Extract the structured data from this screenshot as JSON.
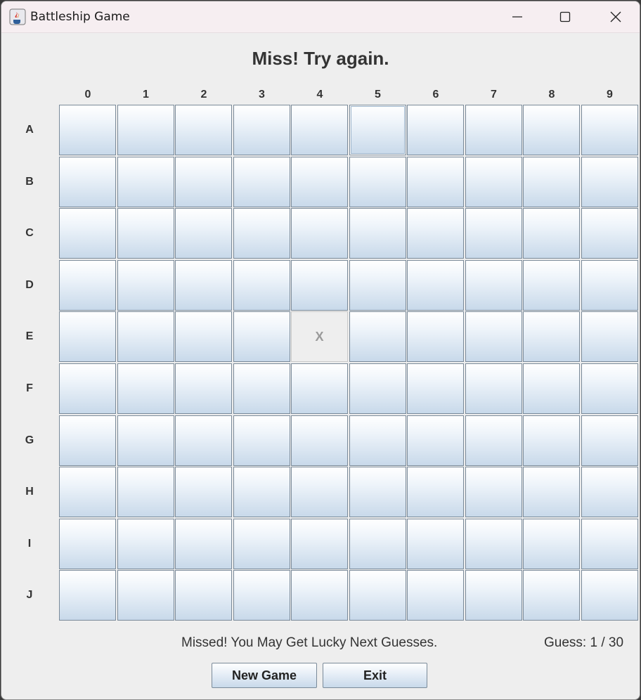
{
  "window": {
    "title": "Battleship Game",
    "icons": {
      "app": "java-coffee-cup-icon",
      "minimize": "minimize-icon",
      "maximize": "maximize-icon",
      "close": "close-icon"
    }
  },
  "heading": "Miss! Try again.",
  "board": {
    "columns": [
      "0",
      "1",
      "2",
      "3",
      "4",
      "5",
      "6",
      "7",
      "8",
      "9"
    ],
    "rows": [
      "A",
      "B",
      "C",
      "D",
      "E",
      "F",
      "G",
      "H",
      "I",
      "J"
    ],
    "revealed": [
      {
        "row": "E",
        "col": "4",
        "mark": "X",
        "state": "miss"
      }
    ],
    "focused": {
      "row": "A",
      "col": "5"
    }
  },
  "status": {
    "message": "Missed! You May Get Lucky Next Guesses.",
    "guess": "Guess: 1 / 30"
  },
  "buttons": {
    "new_game": "New Game",
    "exit": "Exit"
  },
  "colors": {
    "cell_top": "#ffffff",
    "cell_bottom": "#c8d9ea",
    "cell_border": "#7a8a99",
    "miss_fill": "#eeeeee"
  }
}
